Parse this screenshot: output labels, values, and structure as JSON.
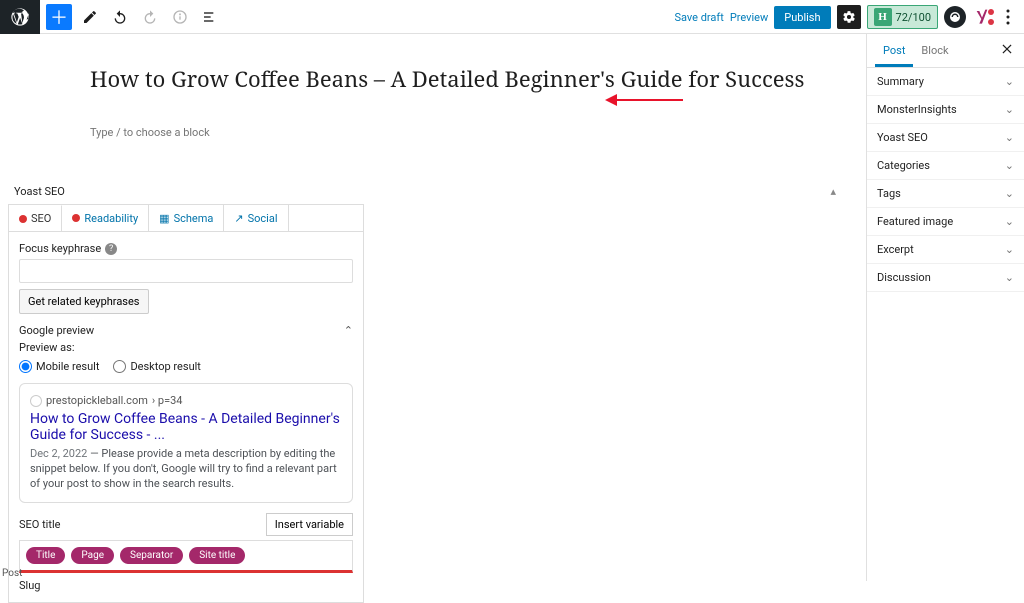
{
  "toolbar": {
    "save_draft": "Save draft",
    "preview": "Preview",
    "publish": "Publish",
    "headline_score": "72/100"
  },
  "sidebar": {
    "tab_post": "Post",
    "tab_block": "Block",
    "panels": [
      "Summary",
      "MonsterInsights",
      "Yoast SEO",
      "Categories",
      "Tags",
      "Featured image",
      "Excerpt",
      "Discussion"
    ]
  },
  "post": {
    "title": "How to Grow Coffee Beans – A Detailed Beginner's Guide for Success",
    "placeholder": "Type / to choose a block"
  },
  "yoast": {
    "section_title": "Yoast SEO",
    "tabs": {
      "seo": "SEO",
      "readability": "Readability",
      "schema": "Schema",
      "social": "Social"
    },
    "focus_label": "Focus keyphrase",
    "get_related": "Get related keyphrases",
    "google_preview": "Google preview",
    "preview_as": "Preview as:",
    "mobile": "Mobile result",
    "desktop": "Desktop result",
    "snippet": {
      "domain": "prestopickleball.com",
      "path": "› p=34",
      "title": "How to Grow Coffee Beans - A Detailed Beginner's Guide for Success - ...",
      "date": "Dec 2, 2022",
      "desc": "Please provide a meta description by editing the snippet below. If you don't, Google will try to find a relevant part of your post to show in the search results."
    },
    "seo_title_label": "SEO title",
    "insert_variable": "Insert variable",
    "pills": [
      "Title",
      "Page",
      "Separator",
      "Site title"
    ],
    "slug_label": "Slug"
  },
  "status": "Post"
}
